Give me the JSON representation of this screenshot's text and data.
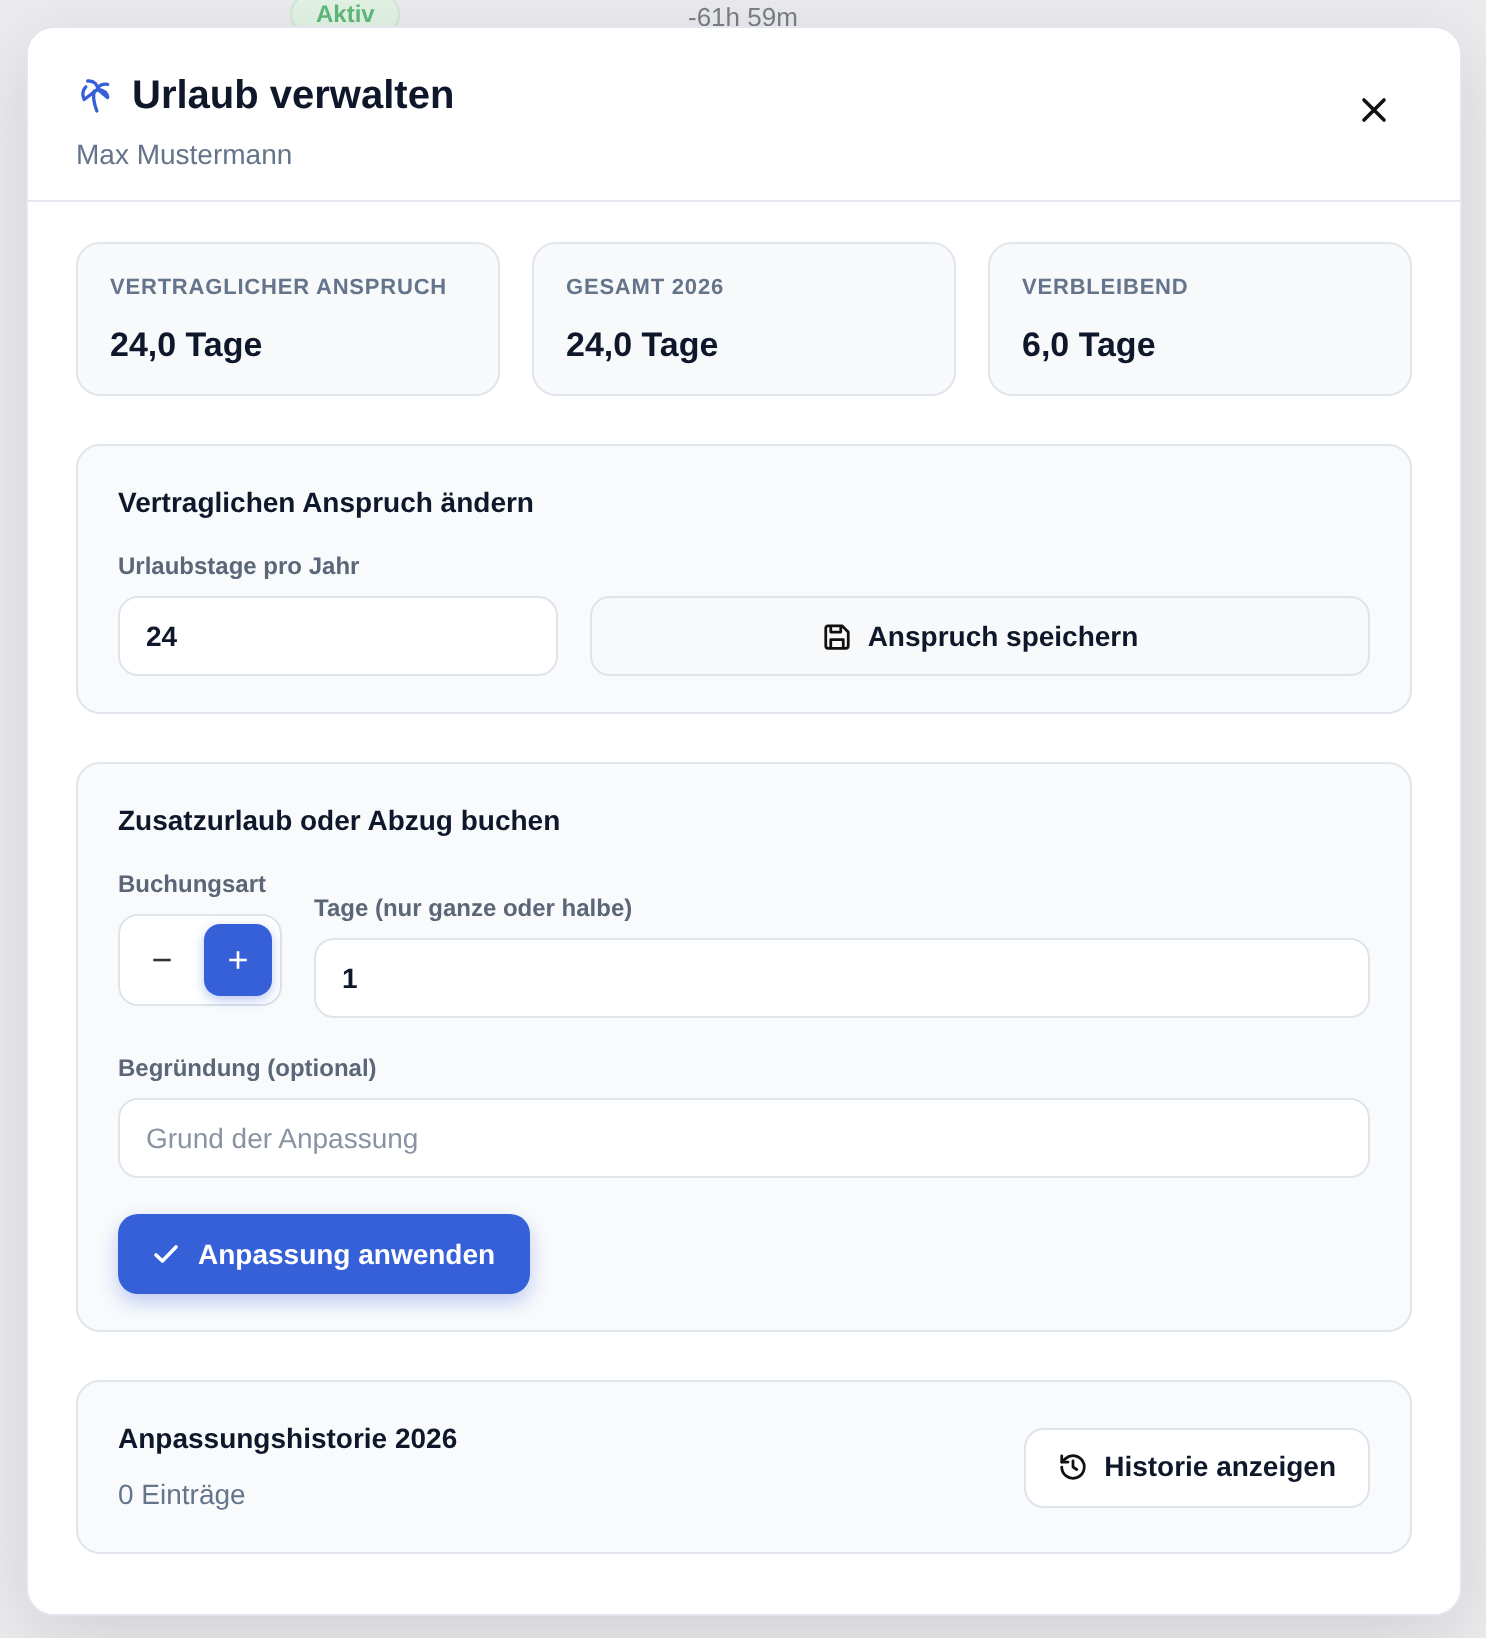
{
  "background": {
    "top_row": {
      "status": "Aktiv",
      "balance": "-61h 59m"
    }
  },
  "dialog": {
    "title": "Urlaub verwalten",
    "subtitle": "Max Mustermann",
    "stats": [
      {
        "label": "VERTRAGLICHER ANSPRUCH",
        "value": "24,0 Tage"
      },
      {
        "label": "GESAMT 2026",
        "value": "24,0 Tage"
      },
      {
        "label": "VERBLEIBEND",
        "value": "6,0 Tage"
      }
    ],
    "entitlement": {
      "heading": "Vertraglichen Anspruch ändern",
      "field_label": "Urlaubstage pro Jahr",
      "value": "24",
      "button": "Anspruch speichern"
    },
    "adjustment": {
      "heading": "Zusatzurlaub oder Abzug buchen",
      "type_label": "Buchungsart",
      "type_options": [
        {
          "symbol": "−",
          "selected": false
        },
        {
          "symbol": "+",
          "selected": true
        }
      ],
      "days_label": "Tage (nur ganze oder halbe)",
      "days_value": "1",
      "reason_label": "Begründung (optional)",
      "reason_placeholder": "Grund der Anpassung",
      "button": "Anpassung anwenden"
    },
    "history": {
      "heading": "Anpassungshistorie 2026",
      "count": "0 Einträge",
      "button": "Historie anzeigen"
    }
  }
}
